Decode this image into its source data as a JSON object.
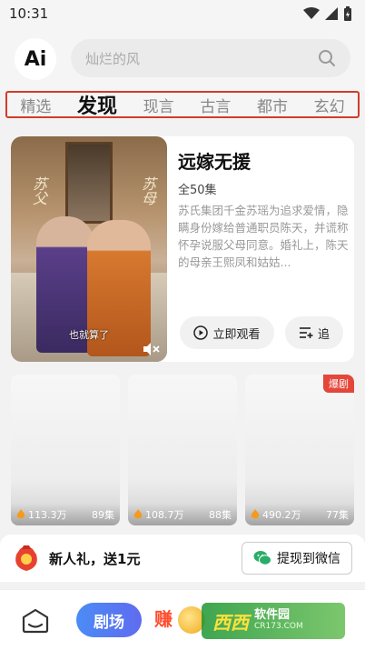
{
  "status_bar": {
    "time": "10:31"
  },
  "header": {
    "logo_text": "Ai",
    "search_placeholder": "灿烂的风"
  },
  "tabs": [
    {
      "label": "精选",
      "active": false
    },
    {
      "label": "发现",
      "active": true
    },
    {
      "label": "现言",
      "active": false
    },
    {
      "label": "古言",
      "active": false
    },
    {
      "label": "都市",
      "active": false
    },
    {
      "label": "玄幻",
      "active": false
    }
  ],
  "featured": {
    "title": "远嫁无援",
    "episodes": "全50集",
    "synopsis": "苏氏集团千金苏瑶为追求爱情，隐瞒身份嫁给普通职员陈天，并谎称怀孕说服父母同意。婚礼上，陈天的母亲王熙凤和姑姑...",
    "poster_left_text": "苏父",
    "poster_right_text": "苏母",
    "poster_subtitle": "也就算了",
    "watch_label": "立即观看",
    "follow_label": "追"
  },
  "cards": [
    {
      "views": "113.3万",
      "episodes": "89集",
      "badge": ""
    },
    {
      "views": "108.7万",
      "episodes": "88集",
      "badge": ""
    },
    {
      "views": "490.2万",
      "episodes": "77集",
      "badge": "爆剧"
    }
  ],
  "promo": {
    "text": "新人礼，送1元",
    "button": "提现到微信"
  },
  "bottom_nav": {
    "theater": "剧场",
    "earn": "赚"
  },
  "watermark": {
    "main": "西西",
    "name": "软件园",
    "url": "CR173.COM"
  },
  "colors": {
    "accent_red": "#d23b2b",
    "nav_blue": "#4b8cf5",
    "badge_red": "#e4463a",
    "wechat_green": "#2aae67"
  }
}
